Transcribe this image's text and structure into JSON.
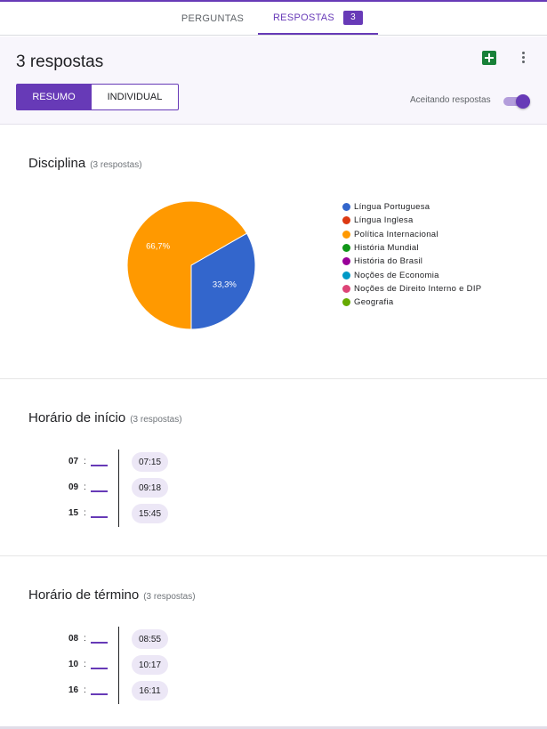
{
  "tabs": {
    "questions_label": "PERGUNTAS",
    "responses_label": "RESPOSTAS",
    "responses_count": "3"
  },
  "header": {
    "title": "3 respostas",
    "segments": {
      "summary": "RESUMO",
      "individual": "INDIVIDUAL"
    },
    "accepting_label": "Aceitando respostas",
    "accepting_on": true,
    "icons": [
      "sheets-icon",
      "more-vert-icon"
    ]
  },
  "questions": {
    "discipline": {
      "title": "Disciplina",
      "subtitle": "(3 respostas)",
      "chart_data": {
        "type": "pie",
        "slices": [
          {
            "label": "Política Internacional",
            "value": 66.7,
            "display": "66,7%",
            "color": "#ff9900"
          },
          {
            "label": "Língua Portuguesa",
            "value": 33.3,
            "display": "33,3%",
            "color": "#3366cc"
          }
        ],
        "legend_placement": "right",
        "legend": [
          {
            "label": "Língua Portuguesa",
            "color": "#3366cc"
          },
          {
            "label": "Língua Inglesa",
            "color": "#dc3912"
          },
          {
            "label": "Política Internacional",
            "color": "#ff9900"
          },
          {
            "label": "História Mundial",
            "color": "#109618"
          },
          {
            "label": "História do Brasil",
            "color": "#990099"
          },
          {
            "label": "Noções de Economia",
            "color": "#0099c6"
          },
          {
            "label": "Noções de Direito Interno e DIP",
            "color": "#dd4477"
          },
          {
            "label": "Geografia",
            "color": "#66aa00"
          }
        ]
      }
    },
    "start_time": {
      "title": "Horário de início",
      "subtitle": "(3 respostas)",
      "rows": [
        {
          "hour": "07",
          "colon": ":",
          "time": "07:15"
        },
        {
          "hour": "09",
          "colon": ":",
          "time": "09:18"
        },
        {
          "hour": "15",
          "colon": ":",
          "time": "15:45"
        }
      ]
    },
    "end_time": {
      "title": "Horário de término",
      "subtitle": "(3 respostas)",
      "rows": [
        {
          "hour": "08",
          "colon": ":",
          "time": "08:55"
        },
        {
          "hour": "10",
          "colon": ":",
          "time": "10:17"
        },
        {
          "hour": "16",
          "colon": ":",
          "time": "16:11"
        }
      ]
    }
  },
  "colors": {
    "accent": "#673ab7",
    "chip": "#ece7f6"
  }
}
